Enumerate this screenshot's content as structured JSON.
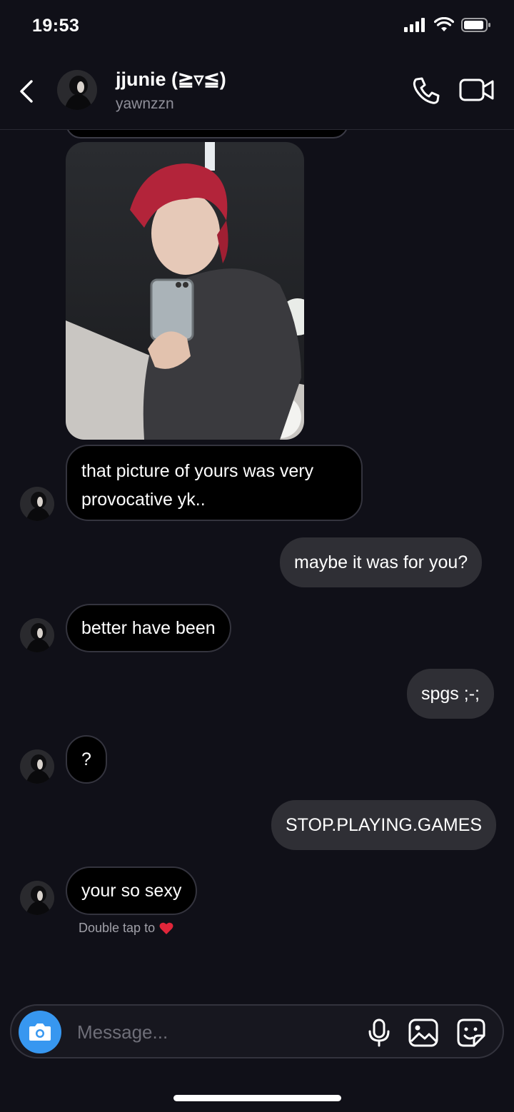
{
  "status_bar": {
    "time": "19:53"
  },
  "header": {
    "name": "jjunie (≧▿≦)",
    "handle": "yawnzzn"
  },
  "messages": [
    {
      "from": "them",
      "type": "image"
    },
    {
      "from": "them",
      "text": "that picture of yours was very provocative yk.."
    },
    {
      "from": "me",
      "text": "maybe it was for you?"
    },
    {
      "from": "them",
      "text": "better have been"
    },
    {
      "from": "me",
      "text": "spgs ;-;"
    },
    {
      "from": "them",
      "text": "?"
    },
    {
      "from": "me",
      "text": "STOP.PLAYING.GAMES"
    },
    {
      "from": "them",
      "text": "your so sexy"
    }
  ],
  "reaction_hint": {
    "text": "Double tap to",
    "icon": "heart-icon",
    "color": "#e0263a"
  },
  "composer": {
    "placeholder": "Message..."
  },
  "colors": {
    "accent": "#3797f0",
    "background": "#101018",
    "outgoing_bubble": "#2f2f35",
    "incoming_bubble": "#000000"
  }
}
